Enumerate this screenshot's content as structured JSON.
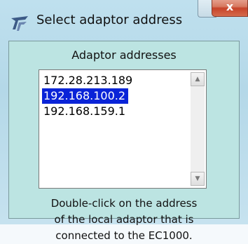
{
  "window": {
    "title": "Select adaptor address",
    "close_label": "x"
  },
  "group": {
    "title": "Adaptor addresses"
  },
  "list": {
    "items": [
      {
        "label": "172.28.213.189",
        "selected": false
      },
      {
        "label": "192.168.100.2",
        "selected": true
      },
      {
        "label": "192.168.159.1",
        "selected": false
      }
    ],
    "scroll_up_glyph": "▲",
    "scroll_down_glyph": "▼"
  },
  "help": {
    "lines": [
      "Double-click on the address",
      "of the local adaptor that is",
      "connected to the EC1000."
    ]
  },
  "colors": {
    "selection_bg": "#0a24d8",
    "panel_bg": "#bce4e2",
    "close_button": "#c7432a"
  },
  "icons": {
    "app_icon": "app-logo-icon",
    "close_icon": "close-icon"
  }
}
